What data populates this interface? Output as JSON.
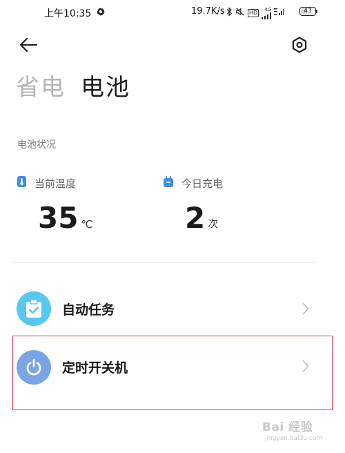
{
  "status_bar": {
    "time": "上午10:35",
    "network_speed": "19.7K/s",
    "network_type": "4G",
    "hd_label": "HD",
    "battery_level": 43,
    "battery_text": "43"
  },
  "header": {
    "tabs": [
      {
        "label": "省电",
        "active": false
      },
      {
        "label": "电池",
        "active": true
      }
    ]
  },
  "battery_status": {
    "title": "电池状况",
    "temperature": {
      "label": "当前温度",
      "value": "35",
      "unit": "℃"
    },
    "charges_today": {
      "label": "今日充电",
      "value": "2",
      "unit": "次"
    }
  },
  "list": {
    "items": [
      {
        "label": "自动任务",
        "icon": "clipboard-check-icon",
        "color": "#57c7ee"
      },
      {
        "label": "定时开关机",
        "icon": "power-icon",
        "color": "#7aa5e3"
      }
    ]
  },
  "colors": {
    "highlight_border": "#d23a3a",
    "temperature_icon": "#3b8fe8",
    "charge_icon": "#3b8fe8"
  },
  "watermark": {
    "text": "Bai 经验",
    "subtext": "jingyan.baidu.com"
  }
}
